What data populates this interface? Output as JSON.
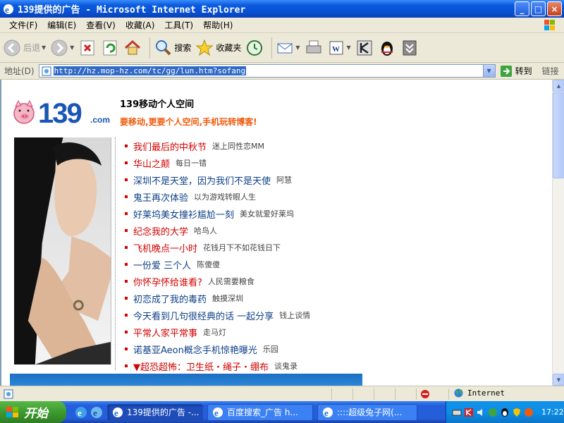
{
  "window": {
    "title": "139提供的广告 - Microsoft Internet Explorer",
    "buttons": {
      "minimize": "_",
      "maximize": "□",
      "close": "×"
    }
  },
  "menu": [
    "文件(F)",
    "编辑(E)",
    "查看(V)",
    "收藏(A)",
    "工具(T)",
    "帮助(H)"
  ],
  "toolbar": {
    "back": "后退",
    "search": "搜索",
    "favorites": "收藏夹"
  },
  "address": {
    "label": "地址(D)",
    "url": "http://hz.mop-hz.com/tc/gg/lun.htm?sofang",
    "go": "转到",
    "links": "链接"
  },
  "page": {
    "logo_number": "139",
    "logo_domain": ".com",
    "title": "139移动个人空间",
    "slogan": "要移动,更要个人空间,手机玩转博客!",
    "articles": [
      {
        "title": "我们最后的中秋节",
        "author": "迷上同性恋MM",
        "color": "red"
      },
      {
        "title": "华山之颠",
        "author": "每日一错",
        "color": "red"
      },
      {
        "title": "深圳不是天堂，因为我们不是天使",
        "author": "阿慧",
        "color": "blue"
      },
      {
        "title": "鬼王再次体验",
        "author": "以为游戏转眼人生",
        "color": "blue"
      },
      {
        "title": "好莱坞美女撞衫尴尬一刻",
        "author": "美女就爱好莱坞",
        "color": "blue"
      },
      {
        "title": "纪念我的大学",
        "author": "哈鸟人",
        "color": "red"
      },
      {
        "title": "飞机晚点一小时",
        "author": "花钱月下不如花钱日下",
        "color": "red"
      },
      {
        "title": "一份爱  三个人",
        "author": "陈傻傻",
        "color": "blue"
      },
      {
        "title": "你怀孕怀给谁看?",
        "author": "人民需要粮食",
        "color": "red"
      },
      {
        "title": "初恋成了我的毒药",
        "author": "触摸深圳",
        "color": "blue"
      },
      {
        "title": "今天看到几句很经典的话  一起分享",
        "author": "钱上谈情",
        "color": "blue"
      },
      {
        "title": "平常人家平常事",
        "author": "走马灯",
        "color": "red"
      },
      {
        "title": "诺基亚Aeon概念手机惊艳曝光",
        "author": "乐园",
        "color": "blue"
      },
      {
        "title": "▼超恐超怖：卫生纸・绳子・绷布",
        "author": "谈鬼录",
        "color": "red"
      }
    ]
  },
  "statusbar": {
    "zone": "Internet"
  },
  "taskbar": {
    "start": "开始",
    "tasks": [
      {
        "label": "139提供的广告 -...",
        "active": true
      },
      {
        "label": "百度搜索_广告 h...",
        "active": false
      },
      {
        "label": "::::超级兔子网(...",
        "active": false
      }
    ],
    "clock": "17:22"
  },
  "colors": {
    "article_red": "#d40000",
    "article_blue": "#0d3f87",
    "slogan": "#f05a0a",
    "logo": "#1a56b5"
  }
}
